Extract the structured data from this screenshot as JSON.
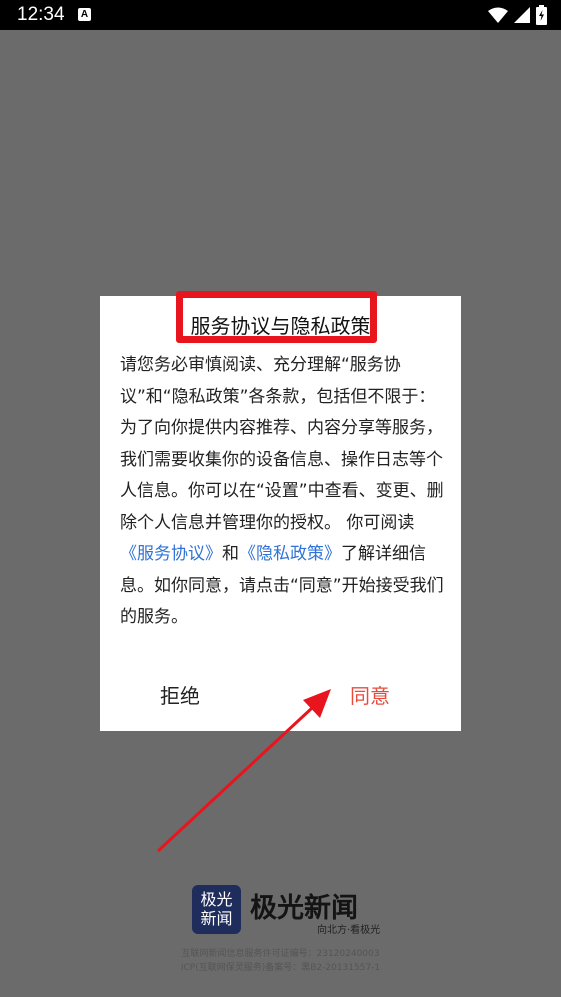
{
  "status_bar": {
    "time": "12:34",
    "notification_icon_letter": "A",
    "icons": [
      "wifi-icon",
      "cellular-signal-icon",
      "battery-icon"
    ]
  },
  "dialog": {
    "title": "服务协议与隐私政策",
    "body": {
      "part1": "请您务必审慎阅读、充分理解“服务协议”和“隐私政策”各条款，包括但不限于：为了向你提供内容推荐、内容分享等服务，我们需要收集你的设备信息、操作日志等个人信息。你可以在“设置”中查看、变更、删除个人信息并管理你的授权。 你可阅读",
      "link_service": "《服务协议》",
      "and": "和",
      "link_privacy": "《隐私政策》",
      "part2": "了解详细信息。如你同意，请点击“同意”开始接受我们的服务。"
    },
    "reject_label": "拒绝",
    "agree_label": "同意"
  },
  "branding": {
    "logo_mark_line1": "极光",
    "logo_mark_line2": "新闻",
    "name": "极光新闻",
    "slogan": "向北方·看极光",
    "license_line1": "互联网新闻信息服务许可证编号：23120240003",
    "license_line2": "ICP(互联网保灵服务)备案号：黑B2-20131557-1"
  },
  "colors": {
    "overlay": "#6b6b6b",
    "highlight_red": "#e8151e",
    "link_blue": "#2f73d6",
    "agree_red": "#e84b3c",
    "logo_navy": "#1f2d5c"
  }
}
